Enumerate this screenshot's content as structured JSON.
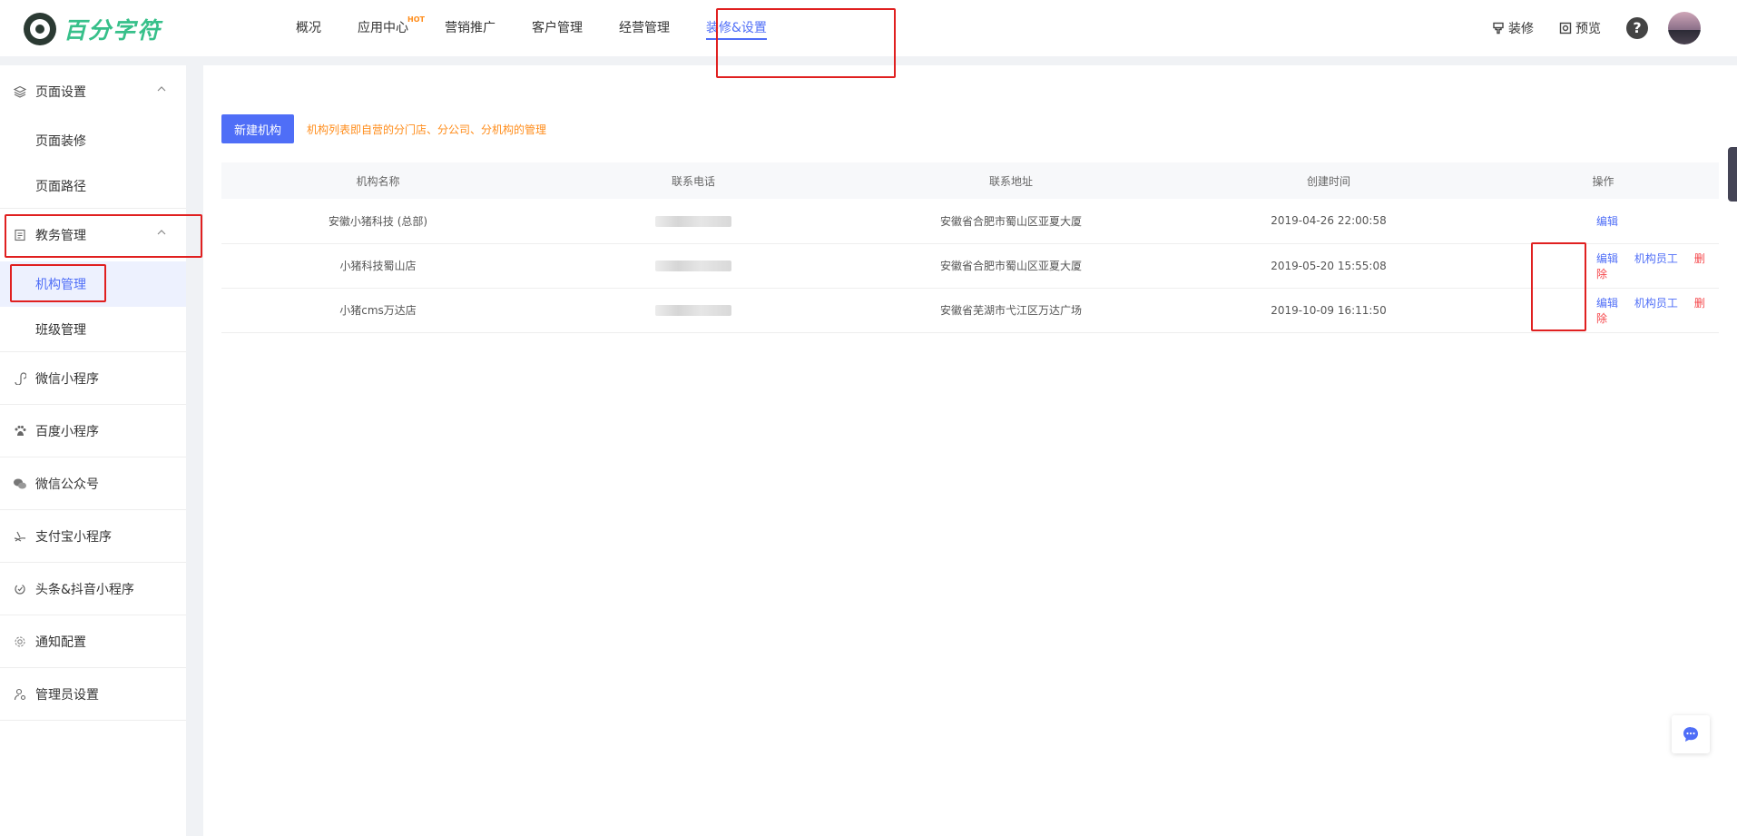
{
  "brand": {
    "name": "百分字符",
    "color": "#37c08a"
  },
  "nav": {
    "items": [
      {
        "label": "概况"
      },
      {
        "label": "应用中心",
        "badge": "HOT"
      },
      {
        "label": "营销推广"
      },
      {
        "label": "客户管理"
      },
      {
        "label": "经营管理"
      },
      {
        "label": "装修&设置",
        "active": true
      }
    ],
    "right": {
      "decorate": "装修",
      "preview": "预览",
      "help": "?"
    }
  },
  "sidebar": {
    "page_settings": {
      "label": "页面设置",
      "children": [
        "页面装修",
        "页面路径"
      ]
    },
    "academic": {
      "label": "教务管理",
      "children": [
        "机构管理",
        "班级管理"
      ],
      "active_child": "机构管理"
    },
    "groups": [
      "微信小程序",
      "百度小程序",
      "微信公众号",
      "支付宝小程序",
      "头条&抖音小程序",
      "通知配置",
      "管理员设置"
    ]
  },
  "toolbar": {
    "new_button": "新建机构",
    "hint": "机构列表即自营的分门店、分公司、分机构的管理"
  },
  "table": {
    "columns": [
      "机构名称",
      "联系电话",
      "联系地址",
      "创建时间",
      "操作"
    ],
    "rows": [
      {
        "name": "安徽小猪科技 (总部)",
        "address": "安徽省合肥市蜀山区亚夏大厦",
        "created": "2019-04-26 22:00:58",
        "ops": [
          "编辑"
        ]
      },
      {
        "name": "小猪科技蜀山店",
        "address": "安徽省合肥市蜀山区亚夏大厦",
        "created": "2019-05-20 15:55:08",
        "ops": [
          "编辑",
          "机构员工",
          "删除"
        ]
      },
      {
        "name": "小猪cms万达店",
        "address": "安徽省芜湖市弋江区万达广场",
        "created": "2019-10-09 16:11:50",
        "ops": [
          "编辑",
          "机构员工",
          "删除"
        ]
      }
    ]
  },
  "colors": {
    "accent": "#4f6ef7",
    "danger": "#f5464a",
    "hint": "#ff8c1a",
    "annotation": "#e02020"
  }
}
